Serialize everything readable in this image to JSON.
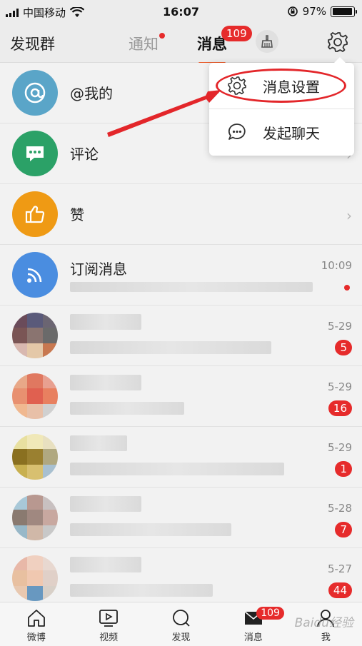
{
  "status_bar": {
    "carrier": "中国移动",
    "time": "16:07",
    "battery": "97%",
    "battery_level": 0.97
  },
  "header": {
    "left_label": "发现群",
    "tabs": [
      {
        "label": "通知",
        "has_dot": true
      },
      {
        "label": "消息",
        "badge": "109",
        "active": true
      }
    ],
    "icons": [
      "broom-icon",
      "gear-icon"
    ]
  },
  "popup_menu": {
    "items": [
      {
        "label": "消息设置",
        "icon": "gear-icon",
        "highlighted": true
      },
      {
        "label": "发起聊天",
        "icon": "chat-bubble-icon"
      }
    ]
  },
  "list": {
    "system_items": [
      {
        "title": "@我的",
        "icon": "at-icon",
        "color": "#5aa5c8"
      },
      {
        "title": "评论",
        "icon": "comment-icon",
        "color": "#2ba167"
      },
      {
        "title": "赞",
        "icon": "thumb-up-icon",
        "color": "#ef9a14"
      },
      {
        "title": "订阅消息",
        "icon": "rss-icon",
        "color": "#4a8de0",
        "time": "10:09",
        "unread_dot": true
      }
    ],
    "conversations": [
      {
        "time": "5-29",
        "badge": "5"
      },
      {
        "time": "5-29",
        "badge": "16"
      },
      {
        "time": "5-29",
        "badge": "1"
      },
      {
        "time": "5-28",
        "badge": "7"
      },
      {
        "time": "5-27",
        "badge": "44"
      }
    ]
  },
  "tab_bar": {
    "items": [
      {
        "label": "微博",
        "icon": "home-icon"
      },
      {
        "label": "视频",
        "icon": "video-icon"
      },
      {
        "label": "发现",
        "icon": "search-icon"
      },
      {
        "label": "消息",
        "icon": "mail-icon",
        "badge": "109"
      },
      {
        "label": "我",
        "icon": "person-icon"
      }
    ]
  },
  "watermark": "Baidu经验",
  "colors": {
    "accent_red": "#e62b2b",
    "active_underline": "#e85c2c",
    "annotation_red": "#e3262a"
  }
}
